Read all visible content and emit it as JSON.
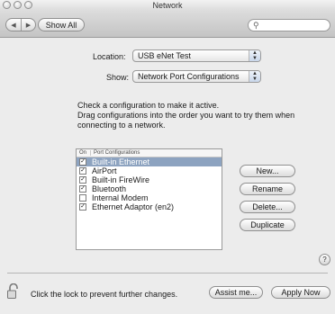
{
  "window": {
    "title": "Network"
  },
  "toolbar": {
    "back_label": "◀",
    "forward_label": "▶",
    "show_all_label": "Show All",
    "search_icon": "search-icon",
    "search_value": ""
  },
  "location": {
    "label": "Location:",
    "value": "USB eNet Test"
  },
  "show": {
    "label": "Show:",
    "value": "Network Port Configurations"
  },
  "instructions": {
    "line1": "Check a configuration to make it active.",
    "line2": "Drag configurations into the order you want to try them when",
    "line3": "connecting to a network."
  },
  "ports": {
    "col_on": "On",
    "col_config": "Port Configurations",
    "items": [
      {
        "name": "Built-in Ethernet",
        "checked": true,
        "selected": true
      },
      {
        "name": "AirPort",
        "checked": true,
        "selected": false
      },
      {
        "name": "Built-in FireWire",
        "checked": true,
        "selected": false
      },
      {
        "name": "Bluetooth",
        "checked": true,
        "selected": false
      },
      {
        "name": "Internal Modem",
        "checked": false,
        "selected": false
      },
      {
        "name": "Ethernet Adaptor (en2)",
        "checked": true,
        "selected": false
      }
    ]
  },
  "actions": {
    "new": "New...",
    "rename": "Rename",
    "delete": "Delete...",
    "duplicate": "Duplicate"
  },
  "help": {
    "label": "?"
  },
  "footer": {
    "lock_message": "Click the lock to prevent further changes.",
    "assist_me": "Assist me...",
    "apply_now": "Apply Now"
  },
  "colors": {
    "selection": "#8da3c0",
    "window_bg": "#ececec"
  }
}
